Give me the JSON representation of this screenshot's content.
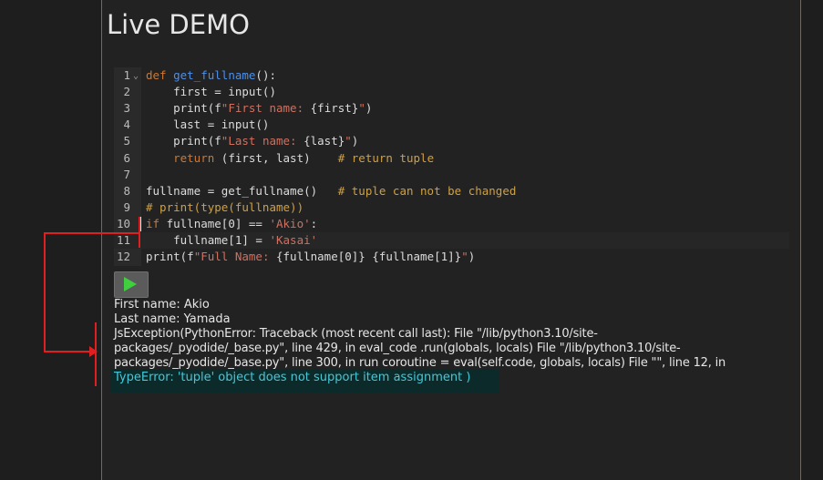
{
  "page": {
    "title": "Live DEMO"
  },
  "editor": {
    "lines": [
      {
        "num": "1",
        "fold": true,
        "tokens": [
          {
            "t": "def ",
            "c": "kw"
          },
          {
            "t": "get_fullname",
            "c": "fn"
          },
          {
            "t": "():",
            "c": "tx"
          }
        ]
      },
      {
        "num": "2",
        "tokens": [
          {
            "t": "    first = input()",
            "c": "tx"
          }
        ]
      },
      {
        "num": "3",
        "tokens": [
          {
            "t": "    print(f",
            "c": "tx"
          },
          {
            "t": "\"First name: ",
            "c": "st"
          },
          {
            "t": "{first}",
            "c": "tx"
          },
          {
            "t": "\"",
            "c": "st"
          },
          {
            "t": ")",
            "c": "tx"
          }
        ]
      },
      {
        "num": "4",
        "tokens": [
          {
            "t": "    last = input()",
            "c": "tx"
          }
        ]
      },
      {
        "num": "5",
        "tokens": [
          {
            "t": "    print(f",
            "c": "tx"
          },
          {
            "t": "\"Last name: ",
            "c": "st"
          },
          {
            "t": "{last}",
            "c": "tx"
          },
          {
            "t": "\"",
            "c": "st"
          },
          {
            "t": ")",
            "c": "tx"
          }
        ]
      },
      {
        "num": "6",
        "tokens": [
          {
            "t": "    ",
            "c": "tx"
          },
          {
            "t": "return",
            "c": "kw"
          },
          {
            "t": " (first, last)    ",
            "c": "tx"
          },
          {
            "t": "# return tuple",
            "c": "cm"
          }
        ]
      },
      {
        "num": "7",
        "tokens": []
      },
      {
        "num": "8",
        "tokens": [
          {
            "t": "fullname = get_fullname()   ",
            "c": "tx"
          },
          {
            "t": "# tuple can not be changed",
            "c": "cm"
          }
        ]
      },
      {
        "num": "9",
        "tokens": [
          {
            "t": "# print(type(fullname))",
            "c": "cm"
          }
        ]
      },
      {
        "num": "10",
        "tokens": [
          {
            "t": "if",
            "c": "kw"
          },
          {
            "t": " fullname[0] == ",
            "c": "tx"
          },
          {
            "t": "'Akio'",
            "c": "st"
          },
          {
            "t": ":",
            "c": "tx"
          }
        ]
      },
      {
        "num": "11",
        "active": true,
        "tokens": [
          {
            "t": "    fullname[1] = ",
            "c": "tx"
          },
          {
            "t": "'Kasai'",
            "c": "st"
          }
        ]
      },
      {
        "num": "12",
        "tokens": [
          {
            "t": "print(f",
            "c": "tx"
          },
          {
            "t": "\"Full Name: ",
            "c": "st"
          },
          {
            "t": "{fullname[0]} {fullname[1]}",
            "c": "tx"
          },
          {
            "t": "\"",
            "c": "st"
          },
          {
            "t": ")",
            "c": "tx"
          }
        ]
      }
    ]
  },
  "run_button": {
    "icon": "play-icon",
    "color": "#3fcf3f"
  },
  "output": {
    "line1": "First name: Akio",
    "line2": "Last name: Yamada",
    "error_trace": "JsException(PythonError: Traceback (most recent call last): File \"/lib/python3.10/site-packages/_pyodide/_base.py\", line 429, in eval_code .run(globals, locals) File \"/lib/python3.10/site-packages/_pyodide/_base.py\", line 300, in run coroutine = eval(self.code, globals, locals) File \"\", line 12, in",
    "type_error": "TypeError: 'tuple' object does not support item assignment )"
  },
  "colors": {
    "annotation": "#e02020",
    "error_text": "#45c8d8"
  }
}
